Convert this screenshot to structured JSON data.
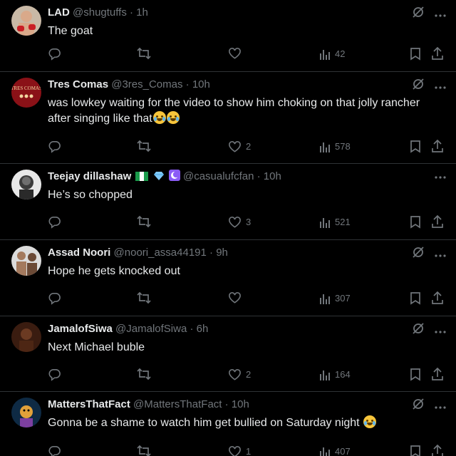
{
  "tweets": [
    {
      "name": "LAD",
      "handle": "@shugtuffs",
      "time": "· 1h",
      "text": "The goat",
      "emojis": 0,
      "likes": "",
      "views": "42",
      "avatar_icon": "fighter-avatar-icon"
    },
    {
      "name": "Tres Comas",
      "handle": "@3res_Comas",
      "time": "· 10h",
      "text": "was lowkey waiting for the video to show him choking on that jolly rancher after singing like that",
      "emojis": 2,
      "likes": "2",
      "views": "578",
      "avatar_icon": "tres-comas-logo-icon",
      "avatar_text": "TRES COMAS"
    },
    {
      "name": "Teejay dillashaw",
      "handle": "@casualufcfan",
      "time": "· 10h",
      "text": "He’s so chopped",
      "emojis": 0,
      "likes": "3",
      "views": "521",
      "avatar_icon": "bald-man-avatar-icon"
    },
    {
      "name": "Assad Noori",
      "handle": "@noori_assa44191",
      "time": "· 9h",
      "text": "Hope he gets knocked out",
      "emojis": 0,
      "likes": "",
      "views": "307",
      "avatar_icon": "fighters-avatar-icon"
    },
    {
      "name": "JamalofSiwa",
      "handle": "@JamalofSiwa",
      "time": "· 6h",
      "text": "Next Michael buble",
      "emojis": 0,
      "likes": "2",
      "views": "164",
      "avatar_icon": "dark-portrait-avatar-icon"
    },
    {
      "name": "MattersThatFact",
      "handle": "@MattersThatFact",
      "time": "· 10h",
      "text": "Gonna be a shame to watch him get bullied on Saturday night",
      "emojis": 1,
      "likes": "1",
      "views": "407",
      "avatar_icon": "cartoon-avatar-icon"
    }
  ],
  "icons": {
    "reply": "reply-icon",
    "retweet": "retweet-icon",
    "like": "heart-icon",
    "views": "views-chart-icon",
    "bookmark": "bookmark-icon",
    "share": "share-icon",
    "grok": "grok-icon",
    "more": "more-icon"
  },
  "colors": {
    "background": "#000000",
    "text": "#e7e9ea",
    "muted": "#71767b",
    "divider": "#2f3336"
  }
}
